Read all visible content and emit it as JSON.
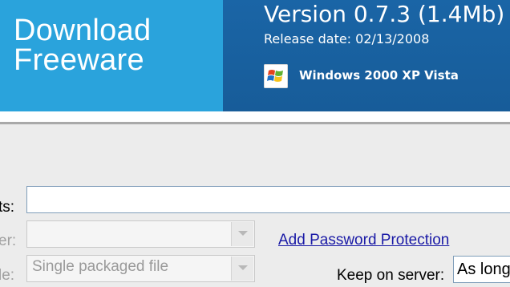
{
  "banner": {
    "brand_line1": "Download",
    "brand_line2": "Freeware",
    "version": "Version 0.7.3 (1.4Mb)",
    "release_date": "Release date: 02/13/2008",
    "os_support": "Windows 2000 XP Vista",
    "os_icon": "windows-logo-icon",
    "colors": {
      "left": "#2aa3dc",
      "right": "#1a65a6"
    }
  },
  "form": {
    "row1_label": "ts:",
    "row1_value": "",
    "row2_label": "er:",
    "row2_value": "",
    "row3_label": "le:",
    "row3_value": "Single packaged file",
    "password_link": "Add Password Protection",
    "keep_label": "Keep on server:",
    "keep_value": "As long"
  }
}
